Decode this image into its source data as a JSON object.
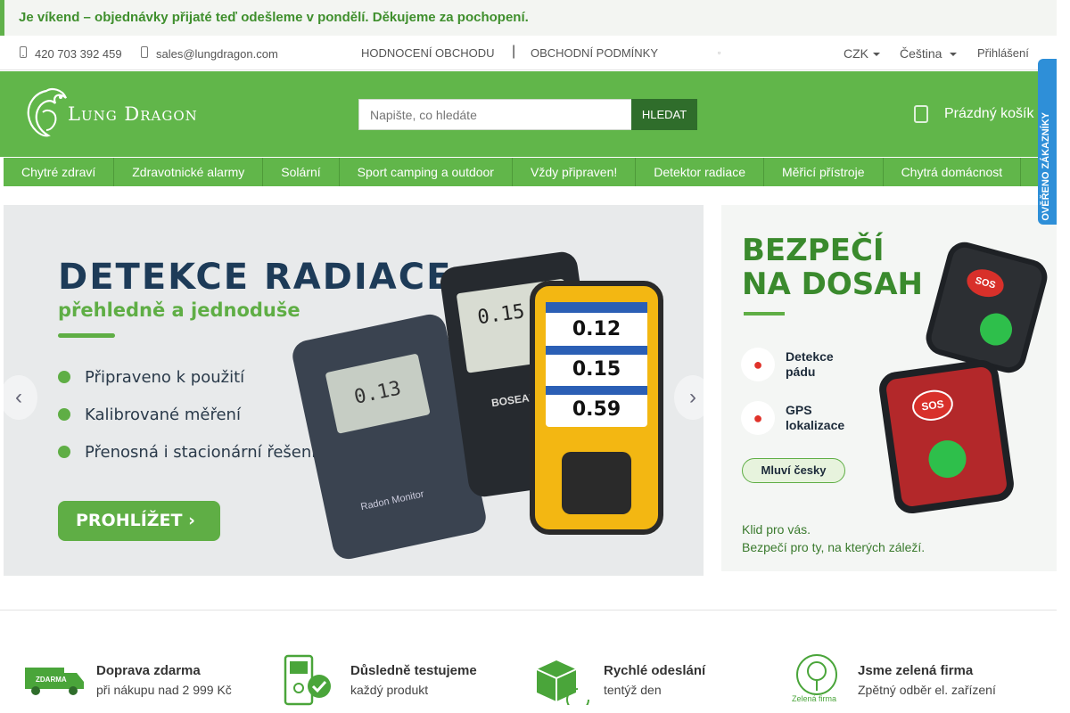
{
  "notice": {
    "text": "Je víkend – objednávky přijaté teď odešleme v pondělí. Děkujeme za pochopení."
  },
  "topbar": {
    "phone": "420 703 392 459",
    "email": "sales@lungdragon.com",
    "links": [
      "HODNOCENÍ OBCHODU",
      "OBCHODNÍ PODMÍNKY"
    ],
    "separator": "|",
    "currency": "CZK",
    "language": "Čeština",
    "login": "Přihlášení"
  },
  "header": {
    "logo_text": "Lung Dragon",
    "search_placeholder": "Napište, co hledáte",
    "search_button": "HLEDAT",
    "cart_label": "Prázdný košík"
  },
  "nav": {
    "items": [
      "Chytré zdraví",
      "Zdravotnické alarmy",
      "Solární",
      "Sport camping a outdoor",
      "Vždy připraven!",
      "Detektor radiace",
      "Měřicí přístroje",
      "Chytrá domácnost"
    ]
  },
  "slide1": {
    "title": "DETEKCE RADIACE",
    "subtitle": "přehledně a jednoduše",
    "bullets": [
      "Připraveno k použití",
      "Kalibrované měření",
      "Přenosná i stacionární řešení"
    ],
    "cta": "PROHLÍŽET",
    "device_values": [
      "0.12",
      "0.15",
      "0.59"
    ],
    "device_brand": "BOSEAN",
    "monitor_label": "Radon Monitor"
  },
  "slide2": {
    "title_line1": "BEZPEČÍ",
    "title_line2": "NA DOSAH",
    "features": [
      {
        "line1": "Detekce",
        "line2": "pádu"
      },
      {
        "line1": "GPS",
        "line2": "lokalizace"
      }
    ],
    "pill": "Mluví česky",
    "footer_line1": "Klid pro vás.",
    "footer_line2": "Bezpečí pro ty, na kterých záleží.",
    "sos": "SOS"
  },
  "badge": {
    "text": "OVĚŘENO ZÁKAZNÍKY"
  },
  "features": [
    {
      "title": "Doprava zdarma",
      "desc": "při nákupu nad 2 999 Kč",
      "icon": "truck-icon",
      "icon_label": "ZDARMA"
    },
    {
      "title": "Důsledně testujeme",
      "desc": "každý produkt",
      "icon": "tested-device-icon"
    },
    {
      "title": "Rychlé odeslání",
      "desc": "tentýž den",
      "icon": "fast-package-icon"
    },
    {
      "title": "Jsme zelená firma",
      "desc": "Zpětný odběr el. zařízení",
      "icon": "green-tree-icon",
      "icon_label": "Zelená firma"
    }
  ],
  "colors": {
    "brand_green": "#61b64a",
    "dark_green": "#2f6d2b",
    "navy": "#1d3b58"
  }
}
